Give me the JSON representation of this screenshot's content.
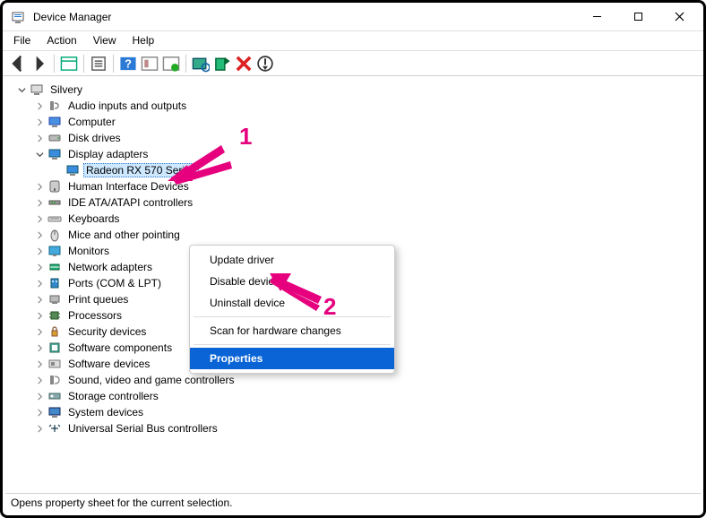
{
  "window": {
    "title": "Device Manager"
  },
  "menu": {
    "file": "File",
    "action": "Action",
    "view": "View",
    "help": "Help"
  },
  "tree": {
    "root": "Silvery",
    "items": [
      "Audio inputs and outputs",
      "Computer",
      "Disk drives",
      "Display adapters",
      "Human Interface Devices",
      "IDE ATA/ATAPI controllers",
      "Keyboards",
      "Mice and other pointing",
      "Monitors",
      "Network adapters",
      "Ports (COM & LPT)",
      "Print queues",
      "Processors",
      "Security devices",
      "Software components",
      "Software devices",
      "Sound, video and game controllers",
      "Storage controllers",
      "System devices",
      "Universal Serial Bus controllers"
    ],
    "display_child": "Radeon RX 570 Series"
  },
  "context_menu": {
    "items": [
      "Update driver",
      "Disable device",
      "Uninstall device",
      "Scan for hardware changes",
      "Properties"
    ],
    "selected_index": 4
  },
  "status": "Opens property sheet for the current selection.",
  "annotations": {
    "n1": "1",
    "n2": "2"
  }
}
